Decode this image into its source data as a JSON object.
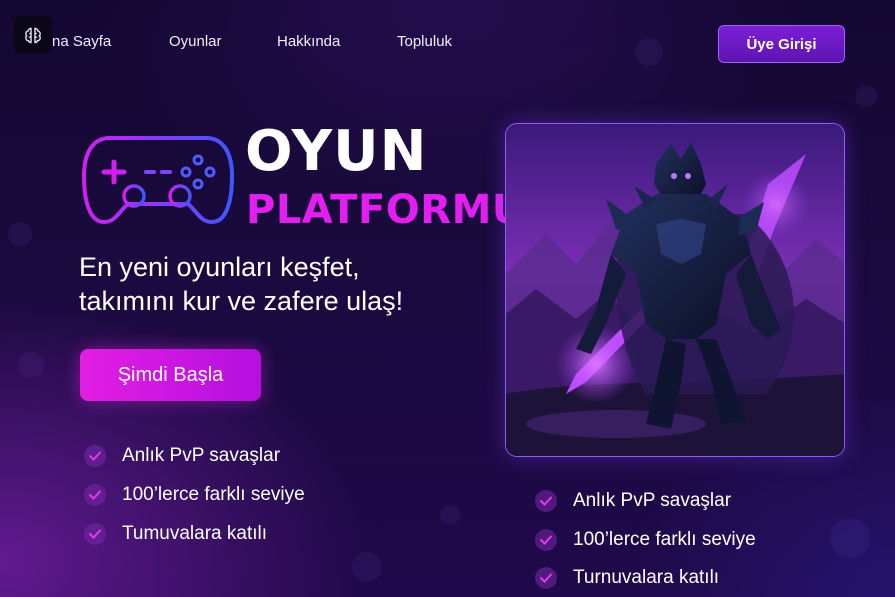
{
  "nav": {
    "logo_icon": "brain-icon",
    "links": [
      "na Sayfa",
      "Oyunlar",
      "Hakkında",
      "Topluluk"
    ],
    "login_label": "Üye Girişi"
  },
  "hero": {
    "title_line1": "OYUN",
    "title_line2": "PLATFORMU",
    "tagline_line1": "En yeni oyunları keşfet,",
    "tagline_line2": "takımını kur ve zafere ulaş!",
    "cta_label": "Şimdi Başla",
    "controller_icon": "gamepad-icon",
    "art_icon": "armored-knight-illustration"
  },
  "features_left": [
    "Anlık PvP savaşlar",
    "100’lerce farklı seviye",
    "Tumuvalara katılı"
  ],
  "features_right": [
    "Anlık PvP savaşlar",
    "100’lerce farklı seviye",
    "Turnuvalara katılı"
  ],
  "colors": {
    "background": "#1a0a3e",
    "accent_magenta": "#e21ef0",
    "accent_purple": "#7b1fd6",
    "check_mark": "#e23ce8"
  }
}
